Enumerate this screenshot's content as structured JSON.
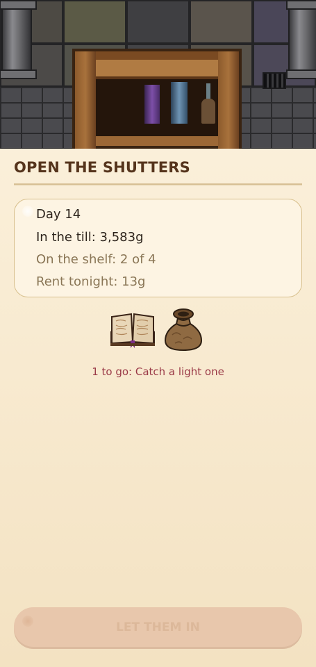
{
  "scene": {
    "description_icons": [
      "stone-wall",
      "stone-pillar",
      "wooden-shelf",
      "purple-book",
      "blue-book",
      "potion-bottle"
    ]
  },
  "header": {
    "title": "OPEN THE SHUTTERS"
  },
  "status": {
    "day": "Day 14",
    "till": "In the till: 3,583g",
    "shelf": "On the shelf: 2 of 4",
    "rent": "Rent tonight: 13g"
  },
  "goal": {
    "icons": [
      "spellbook-icon",
      "sack-icon"
    ],
    "text": "1 to go: Catch a light one"
  },
  "cta": {
    "label": "LET THEM IN",
    "enabled": false
  },
  "colors": {
    "title": "#55341c",
    "goal_text": "#9a3947",
    "card_border": "#d7bf8c",
    "cta_bg": "#e8c7ac",
    "cta_text": "#dcb89a"
  }
}
